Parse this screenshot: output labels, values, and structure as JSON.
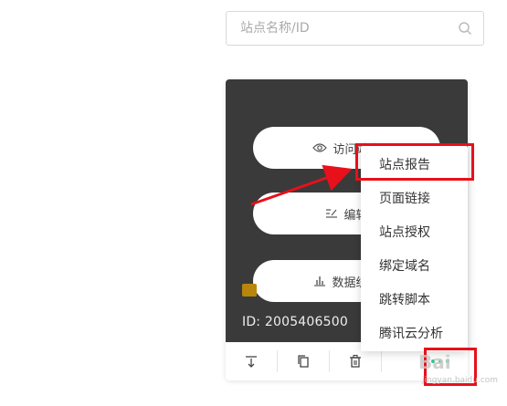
{
  "search": {
    "placeholder": "站点名称/ID",
    "icon": "search-icon"
  },
  "card": {
    "actions": [
      {
        "label": "访问站点",
        "icon": "eye-icon"
      },
      {
        "label": "编辑",
        "icon": "edit-icon"
      },
      {
        "label": "数据统计",
        "icon": "bar-chart-icon"
      }
    ],
    "site_id": "ID:  2005406500",
    "footer": [
      {
        "icon": "download-icon"
      },
      {
        "icon": "copy-icon"
      },
      {
        "icon": "trash-icon"
      },
      {
        "icon": "more-icon"
      }
    ]
  },
  "menu": {
    "items": [
      "站点报告",
      "页面链接",
      "站点授权",
      "绑定域名",
      "跳转脚本",
      "腾讯云分析"
    ]
  },
  "annotation_color": "#e8101a",
  "watermark": {
    "text": "Bai",
    "sub": "jingyan.baidu.com"
  }
}
